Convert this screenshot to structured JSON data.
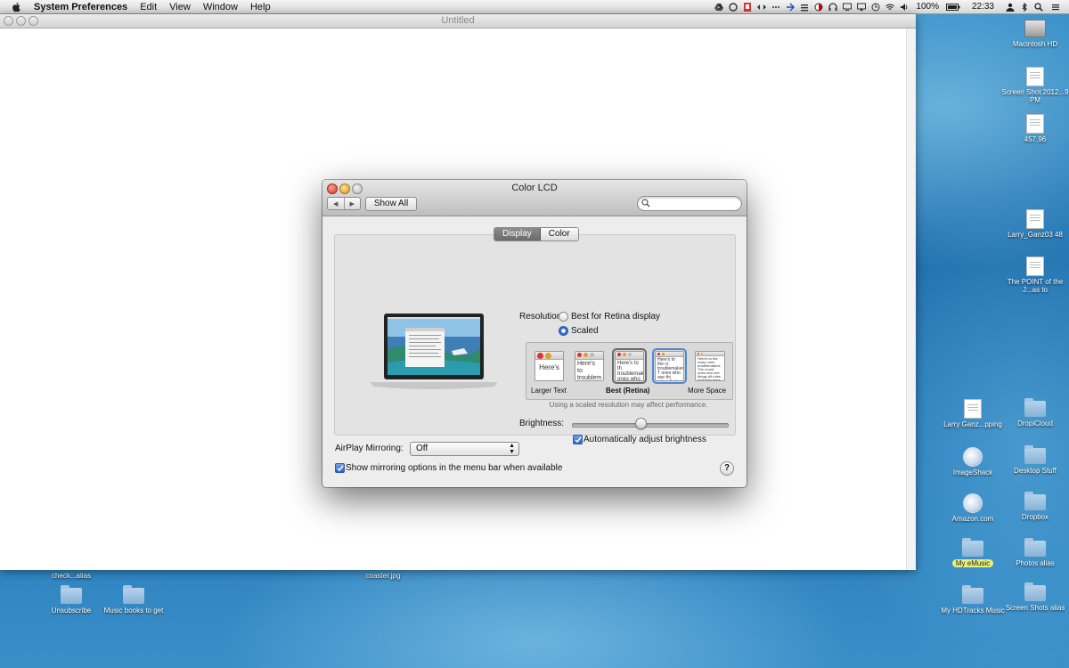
{
  "menubar": {
    "app_name": "System Preferences",
    "menus": [
      "Edit",
      "View",
      "Window",
      "Help"
    ],
    "battery": "100%",
    "time": "22:33"
  },
  "background_window": {
    "title": "Untitled"
  },
  "dialog": {
    "title": "Color LCD",
    "show_all": "Show All",
    "search_placeholder": "",
    "tabs": [
      "Display",
      "Color"
    ],
    "resolution_label": "Resolution:",
    "resolution_options": [
      "Best for Retina display",
      "Scaled"
    ],
    "scaled_options": {
      "larger_text": "Larger Text",
      "best": "Best (Retina)",
      "more_space": "More Space",
      "thumb_texts": [
        "Here's",
        "Here's to troublem",
        "Here's to th troublemake ones who se",
        "Here's to the cr troublemakers. T ones who see thi rules. And they",
        "Here's to the crazy ones troublemakers. The round ones who see things dif rules. And they have no"
      ]
    },
    "scaled_note": "Using a scaled resolution may affect performance.",
    "brightness_label": "Brightness:",
    "brightness_value": 0.44,
    "auto_brightness": "Automatically adjust brightness",
    "airplay_label": "AirPlay Mirroring:",
    "airplay_value": "Off",
    "mirror_option": "Show mirroring options in the menu bar when available",
    "help": "?"
  },
  "desktop": {
    "right_icons": [
      "Macintosh HD",
      "Screen Shot 2012...9 PM",
      "457.96",
      "Larry_Ganz03 48",
      "The POINT of the J...as to",
      "Larry Ganz...pping",
      "DropiCloud",
      "ImageShack",
      "Desktop Stuff",
      "Amazon.com",
      "Dropbox",
      "My eMusic",
      "Photos alias",
      "My HDTracks Music",
      "Screen Shots alias"
    ],
    "bottom_icons": [
      "check...alias",
      "coaster.jpg",
      "Unsubscribe",
      "Music books to get"
    ]
  },
  "colors": {
    "accent": "#2463c4",
    "desktop": "#1f6fae"
  }
}
